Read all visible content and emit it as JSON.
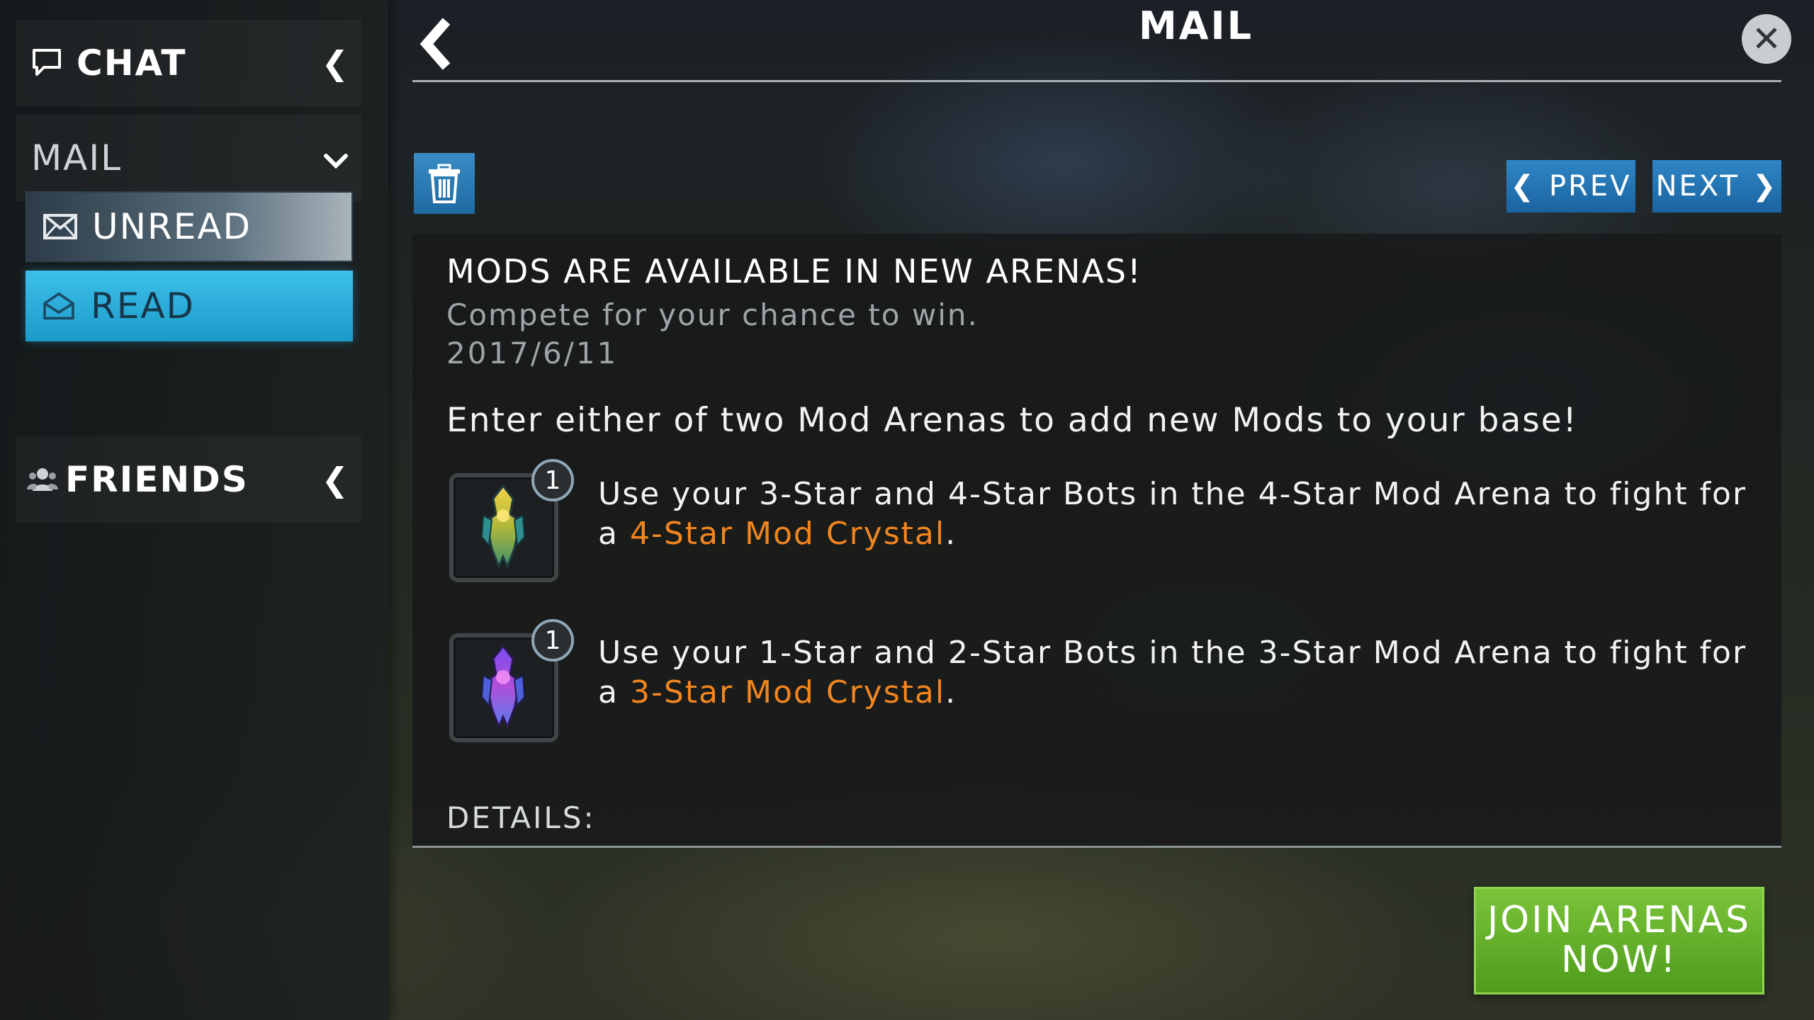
{
  "sidebar": {
    "chat_label": "CHAT",
    "mail_label": "MAIL",
    "unread_label": "UNREAD",
    "read_label": "READ",
    "friends_label": "FRIENDS"
  },
  "header": {
    "title": "MAIL",
    "prev_label": "PREV",
    "next_label": "NEXT"
  },
  "message": {
    "title": "MODS ARE AVAILABLE IN NEW ARENAS!",
    "subtitle": "Compete for your chance to win.",
    "date": "2017/6/11",
    "intro": "Enter either of two Mod Arenas to add new Mods to your base!",
    "rewards": [
      {
        "count": "1",
        "text_before": "Use your 3-Star and 4-Star Bots in the 4-Star Mod Arena to fight for a ",
        "highlight": "4-Star Mod Crystal",
        "text_after": "."
      },
      {
        "count": "1",
        "text_before": "Use your 1-Star and 2-Star Bots in the 3-Star Mod Arena to fight for a ",
        "highlight": "3-Star Mod Crystal",
        "text_after": "."
      }
    ],
    "details_label": "DETAILS:"
  },
  "footer": {
    "join_line1": "JOIN ARENAS",
    "join_line2": "NOW!"
  },
  "colors": {
    "accent_blue": "#1c9ac9",
    "highlight_orange": "#f2851e",
    "join_green": "#5fae28"
  },
  "icons": [
    "chat-bubble-icon",
    "mail-closed-icon",
    "mail-open-icon",
    "friends-icon",
    "back-arrow-icon",
    "close-icon",
    "trash-icon",
    "chevron-left-icon",
    "chevron-right-icon",
    "chevron-down-icon",
    "mod-crystal-icon"
  ]
}
